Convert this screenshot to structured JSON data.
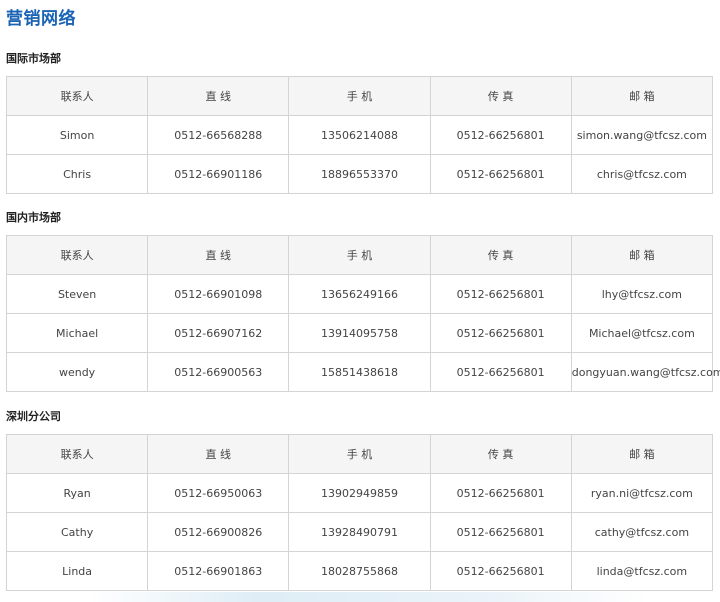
{
  "page_title": "营销网络",
  "columns": [
    "联系人",
    "直 线",
    "手 机",
    "传 真",
    "邮 箱"
  ],
  "sections": [
    {
      "title": "国际市场部",
      "rows": [
        [
          "Simon",
          "0512-66568288",
          "13506214088",
          "0512-66256801",
          "simon.wang@tfcsz.com"
        ],
        [
          "Chris",
          "0512-66901186",
          "18896553370",
          "0512-66256801",
          "chris@tfcsz.com"
        ]
      ]
    },
    {
      "title": "国内市场部",
      "rows": [
        [
          "Steven",
          "0512-66901098",
          "13656249166",
          "0512-66256801",
          "lhy@tfcsz.com"
        ],
        [
          "Michael",
          "0512-66907162",
          "13914095758",
          "0512-66256801",
          "Michael@tfcsz.com"
        ],
        [
          "wendy",
          "0512-66900563",
          "15851438618",
          "0512-66256801",
          "dongyuan.wang@tfcsz.com"
        ]
      ]
    },
    {
      "title": "深圳分公司",
      "rows": [
        [
          "Ryan",
          "0512-66950063",
          "13902949859",
          "0512-66256801",
          "ryan.ni@tfcsz.com"
        ],
        [
          "Cathy",
          "0512-66900826",
          "13928490791",
          "0512-66256801",
          "cathy@tfcsz.com"
        ],
        [
          "Linda",
          "0512-66901863",
          "18028755868",
          "0512-66256801",
          "linda@tfcsz.com"
        ]
      ]
    }
  ]
}
